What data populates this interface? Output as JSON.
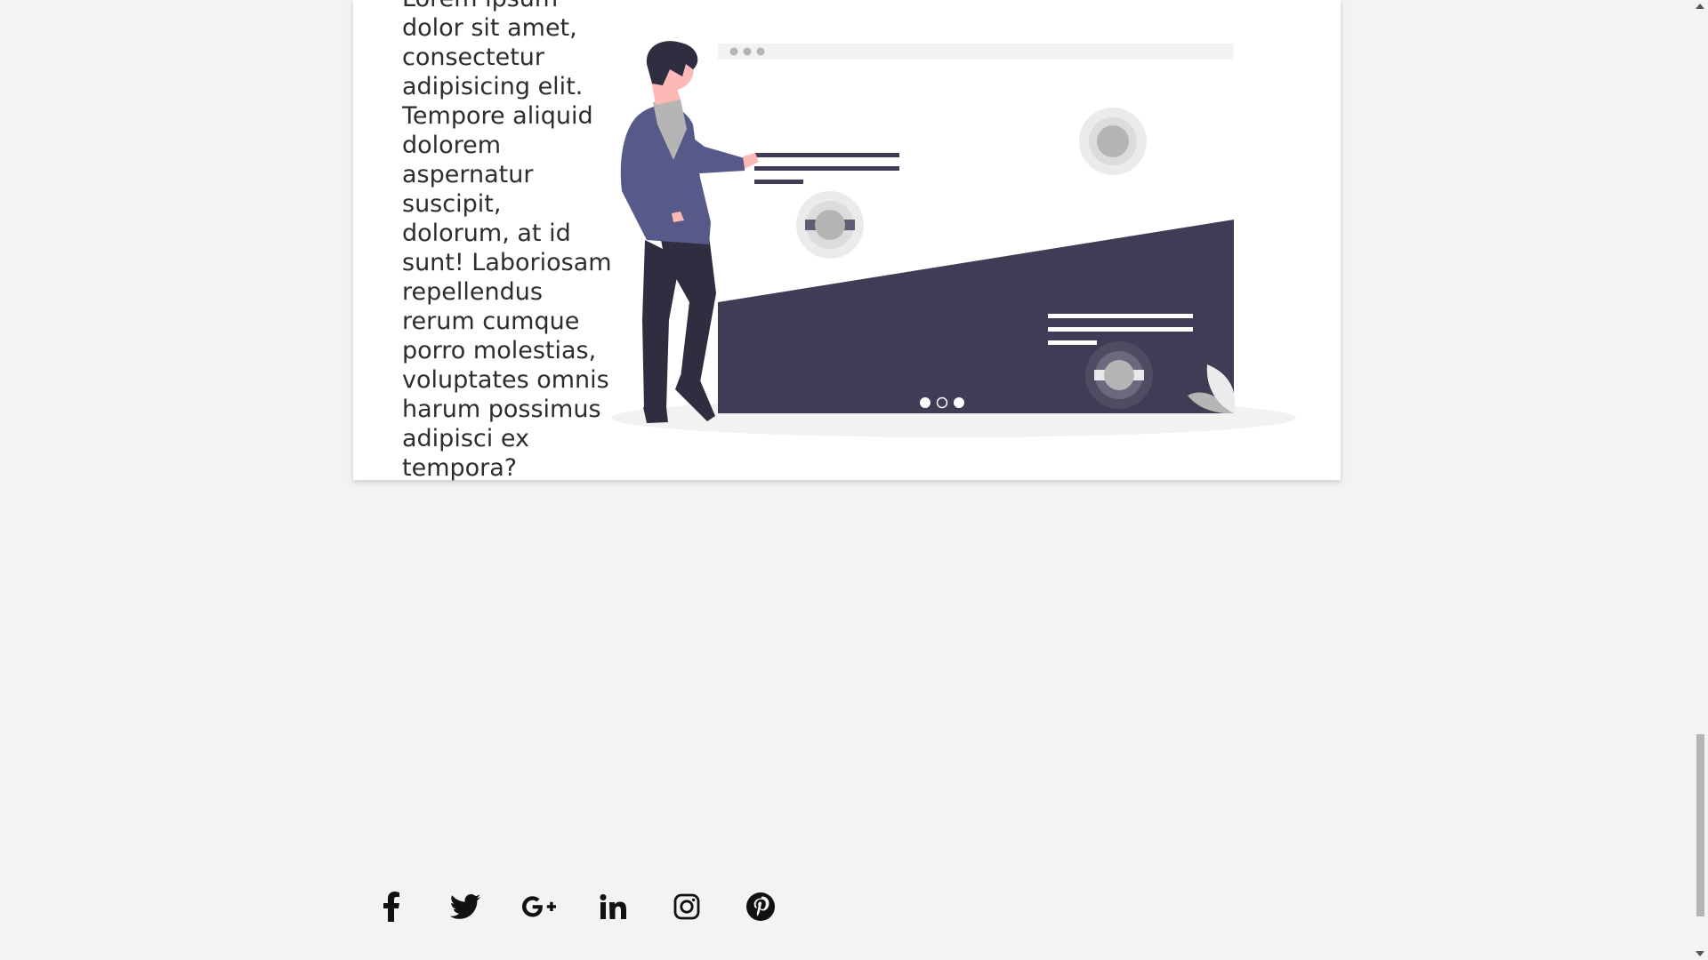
{
  "card": {
    "paragraph": "Lorem ipsum dolor sit amet, consectetur adipisicing elit. Tempore aliquid dolorem aspernatur suscipit, dolorum, at id sunt! Laboriosam repellendus rerum cumque porro molestias, voluptates omnis harum possimus adipisci ex tempora?"
  },
  "social_links": [
    {
      "name": "facebook",
      "icon": "facebook-icon"
    },
    {
      "name": "twitter",
      "icon": "twitter-icon"
    },
    {
      "name": "google-plus",
      "icon": "google-plus-icon"
    },
    {
      "name": "linkedin",
      "icon": "linkedin-icon"
    },
    {
      "name": "instagram",
      "icon": "instagram-icon"
    },
    {
      "name": "pinterest",
      "icon": "pinterest-icon"
    }
  ],
  "colors": {
    "background": "#f3f3f3",
    "card": "#ffffff",
    "illustration_dark": "#3f3d56",
    "jacket": "#575a89",
    "skin": "#ffb8b8",
    "accent_grey": "#b5b5b5"
  }
}
